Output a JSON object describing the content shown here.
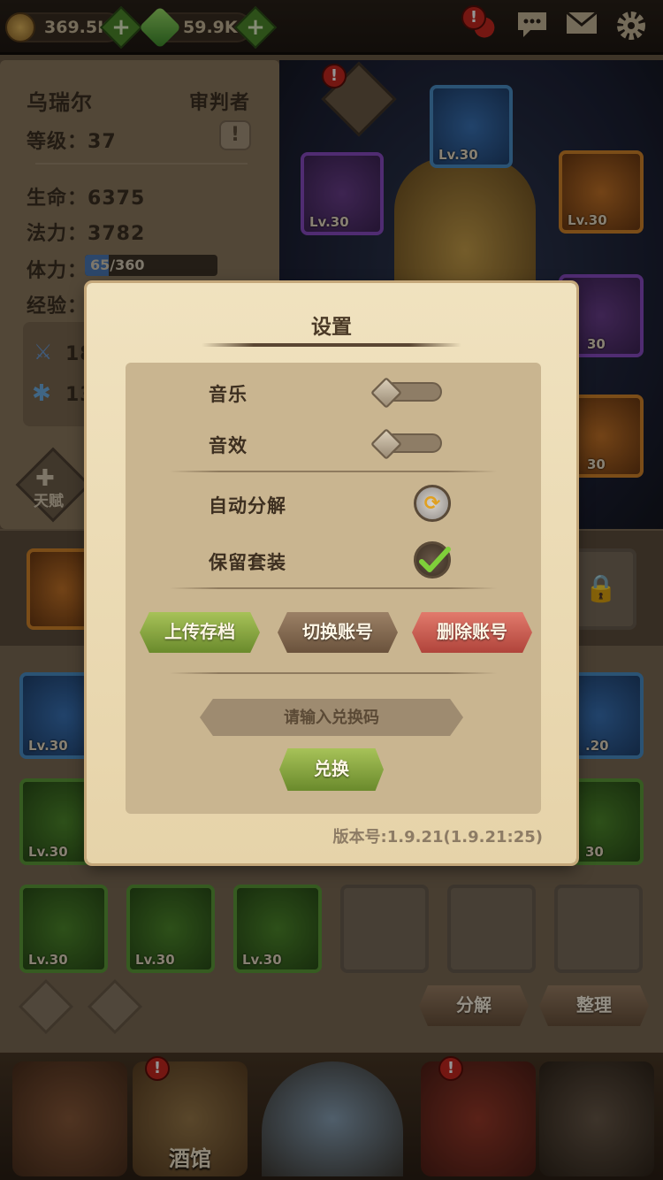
{
  "topbar": {
    "gold": "369.5K",
    "gems": "59.9K",
    "alert_mark": "!"
  },
  "character": {
    "name": "乌瑞尔",
    "class": "审判者",
    "level_label": "等级：",
    "level": "37",
    "hp_label": "生命：",
    "hp": "6375",
    "mp_label": "法力：",
    "mp": "3782",
    "stamina_label": "体力：",
    "stamina": "65/360",
    "stamina_fill": 0.18,
    "exp_label": "经验：",
    "attack_partial": "18",
    "defense_partial": "13",
    "talent_label": "天赋"
  },
  "equipment_scene": {
    "slots": [
      {
        "level": "Lv.30",
        "rarity": "blue"
      },
      {
        "level": "Lv.30",
        "rarity": "purple"
      },
      {
        "level": "Lv.30",
        "rarity": "orange"
      },
      {
        "level": "30",
        "rarity": "purple"
      },
      {
        "level": "30",
        "rarity": "orange"
      }
    ]
  },
  "inventory": {
    "items": [
      {
        "level": "Lv.30",
        "rarity": "blue"
      },
      {
        "level": ".20",
        "rarity": "blue"
      },
      {
        "level": "Lv.30",
        "rarity": "green"
      },
      {
        "level": "30",
        "rarity": "green"
      },
      {
        "level": "Lv.30",
        "rarity": "green"
      },
      {
        "level": "Lv.30",
        "rarity": "green"
      },
      {
        "level": "Lv.30",
        "rarity": "green"
      }
    ],
    "decompose_label": "分解",
    "sort_label": "整理"
  },
  "nav": {
    "tavern_label": "酒馆"
  },
  "settings": {
    "title": "设置",
    "music_label": "音乐",
    "music_on": false,
    "sfx_label": "音效",
    "sfx_on": false,
    "auto_decompose_label": "自动分解",
    "keep_sets_label": "保留套装",
    "keep_sets_checked": true,
    "upload_save_label": "上传存档",
    "switch_account_label": "切换账号",
    "delete_account_label": "删除账号",
    "code_placeholder": "请输入兑换码",
    "redeem_label": "兑换",
    "version": "版本号:1.9.21(1.9.21:25)"
  },
  "colors": {
    "dialog_bg": "#efe0bc",
    "inner_bg": "#c9b590",
    "button_green": "#8aa844",
    "button_brown": "#836a52",
    "button_red": "#cc5e53"
  }
}
